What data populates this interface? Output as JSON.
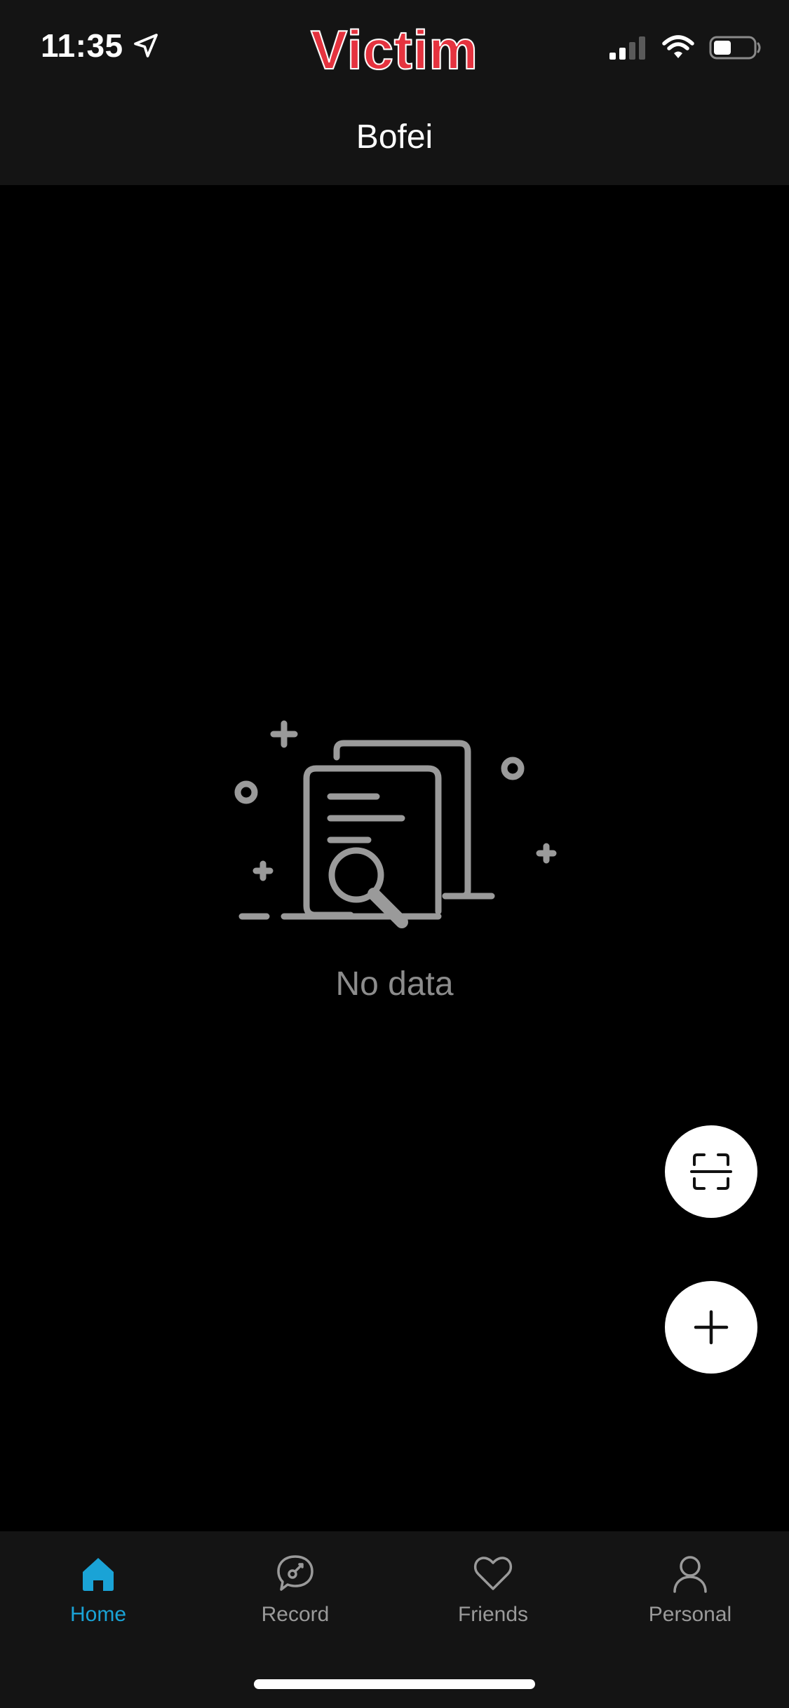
{
  "status_bar": {
    "time": "11:35",
    "watermark": "Victim",
    "location_icon": "location-arrow-icon",
    "signal_icon": "cellular-signal-icon",
    "wifi_icon": "wifi-icon",
    "battery_icon": "battery-icon",
    "battery_level": 0.45
  },
  "header": {
    "title": "Bofei"
  },
  "empty_state": {
    "icon": "document-search-icon",
    "text": "No data"
  },
  "fabs": {
    "scan_icon": "scan-icon",
    "add_icon": "plus-icon"
  },
  "tab_bar": {
    "active_color": "#1aa3d6",
    "inactive_color": "#9a9a9a",
    "tabs": [
      {
        "label": "Home",
        "icon": "home-icon",
        "active": true
      },
      {
        "label": "Record",
        "icon": "record-icon",
        "active": false
      },
      {
        "label": "Friends",
        "icon": "heart-icon",
        "active": false
      },
      {
        "label": "Personal",
        "icon": "person-icon",
        "active": false
      }
    ]
  }
}
